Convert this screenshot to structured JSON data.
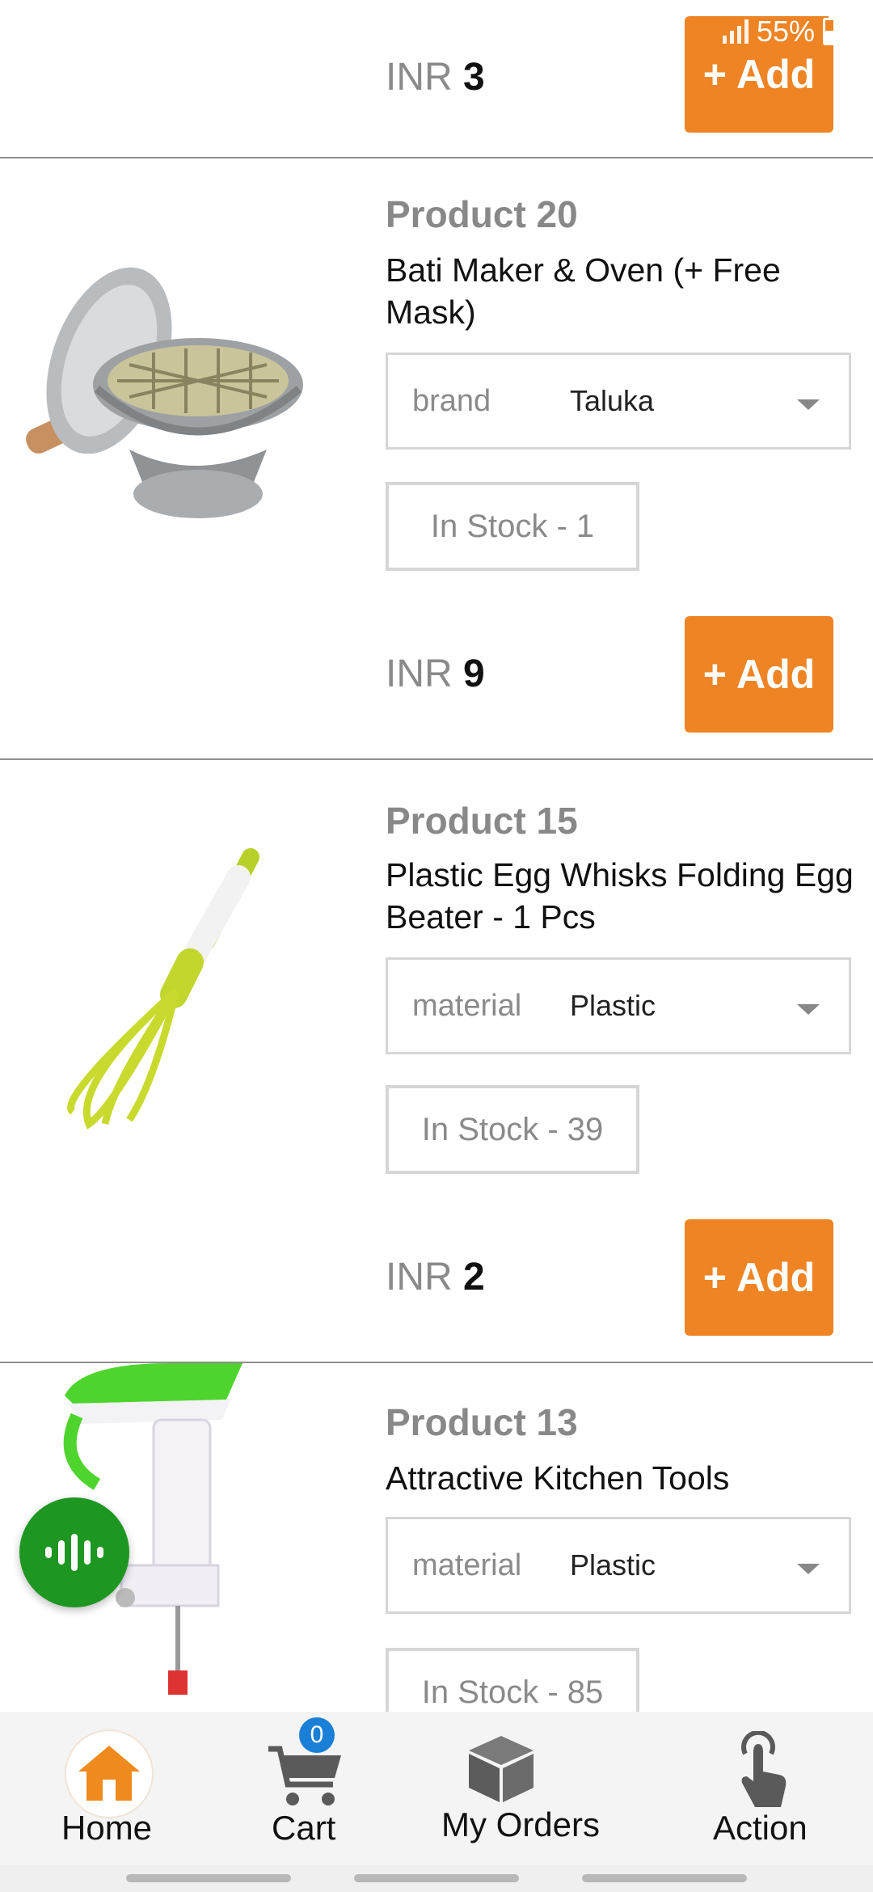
{
  "status_bar": {
    "battery": "55%"
  },
  "currency": "INR",
  "add_label": "+ Add",
  "products": [
    {
      "price": "3"
    },
    {
      "title": "Product 20",
      "description": "Bati Maker & Oven (+ Free Mask)",
      "variant": {
        "attribute": "brand",
        "value": "Taluka"
      },
      "stock": "In Stock - 1",
      "price": "9"
    },
    {
      "title": "Product 15",
      "description": "Plastic Egg Whisks Folding Egg Beater - 1 Pcs",
      "variant": {
        "attribute": "material",
        "value": "Plastic"
      },
      "stock": "In Stock - 39",
      "price": "2"
    },
    {
      "title": "Product 13",
      "description": "Attractive Kitchen Tools",
      "variant": {
        "attribute": "material",
        "value": "Plastic"
      },
      "stock": "In Stock - 85"
    }
  ],
  "bottom_nav": {
    "home": "Home",
    "cart": "Cart",
    "cart_count": "0",
    "orders": "My Orders",
    "action": "Action"
  },
  "colors": {
    "accent": "#ee8424",
    "fab": "#1e9622",
    "badge": "#1a7fd6"
  },
  "icons": [
    "signal-icon",
    "battery-icon",
    "home-icon",
    "cart-icon",
    "box-icon",
    "tap-icon",
    "voice-icon",
    "dropdown-caret-icon"
  ]
}
